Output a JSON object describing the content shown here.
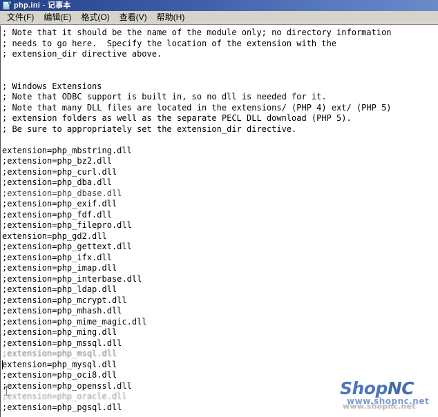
{
  "window": {
    "title": "php.ini - 记事本",
    "icon": "notepad-document-icon",
    "titlebar_color_left": "#26428a",
    "titlebar_color_right": "#6b8acb",
    "menubar_color": "#d6d3ca"
  },
  "menu": {
    "items": [
      {
        "label": "文件(F)"
      },
      {
        "label": "编辑(E)"
      },
      {
        "label": "格式(O)"
      },
      {
        "label": "查看(V)"
      },
      {
        "label": "帮助(H)"
      }
    ]
  },
  "editor": {
    "lines": [
      "; Note that it should be the name of the module only; no directory information",
      "; needs to go here.  Specify the location of the extension with the",
      "; extension_dir directive above.",
      "",
      "",
      "; Windows Extensions",
      "; Note that ODBC support is built in, so no dll is needed for it.",
      "; Note that many DLL files are located in the extensions/ (PHP 4) ext/ (PHP 5)",
      "; extension folders as well as the separate PECL DLL download (PHP 5).",
      "; Be sure to appropriately set the extension_dir directive.",
      "",
      "extension=php_mbstring.dll",
      ";extension=php_bz2.dll",
      ";extension=php_curl.dll",
      ";extension=php_dba.dll",
      ";extension=php_dbase.dll",
      ";extension=php_exif.dll",
      ";extension=php_fdf.dll",
      ";extension=php_filepro.dll",
      "extension=php_gd2.dll",
      ";extension=php_gettext.dll",
      ";extension=php_ifx.dll",
      ";extension=php_imap.dll",
      ";extension=php_interbase.dll",
      ";extension=php_ldap.dll",
      ";extension=php_mcrypt.dll",
      ";extension=php_mhash.dll",
      ";extension=php_mime_magic.dll",
      ";extension=php_ming.dll",
      ";extension=php_mssql.dll",
      ";extension=php_msql.dll",
      "extension=php_mysql.dll",
      ";extension=php_oci8.dll",
      ";extension=php_openssl.dll",
      ";extension=php_oracle.dll",
      ";extension=php_pgsql.dll"
    ],
    "caret_line_index": 31
  },
  "watermark": {
    "brand_shop": "Shop",
    "brand_nc": "NC",
    "url": "www.shopnc.net",
    "ghost": "www.shopnc.net",
    "color": "#2f5fb0"
  }
}
